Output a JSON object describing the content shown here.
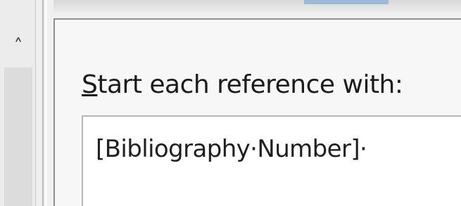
{
  "field": {
    "label_accel": "S",
    "label_rest": "tart each reference with:",
    "value": "[Bibliography·Number]·"
  },
  "icons": {
    "scroll_up": "chevron-up-icon"
  }
}
